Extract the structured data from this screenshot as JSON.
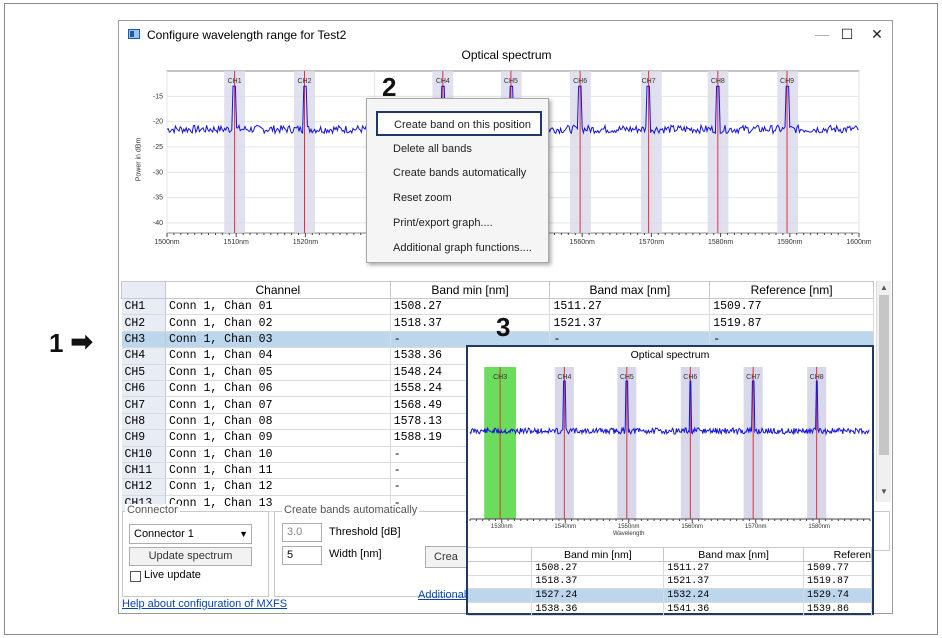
{
  "window": {
    "title": "Configure wavelength range for Test2",
    "minimize_glyph": "—",
    "maximize_glyph": "☐",
    "close_glyph": "✕"
  },
  "chart": {
    "title": "Optical spectrum",
    "ylabel": "Power in dBm"
  },
  "chart_data": [
    {
      "type": "line",
      "title": "Optical spectrum",
      "ylabel": "Power in dBm",
      "xlabel": "",
      "x_ticks": [
        "1500nm",
        "1510nm",
        "1520nm",
        "153",
        "1560nm",
        "1570nm",
        "1580nm",
        "1590nm",
        "1600nm"
      ],
      "y_ticks": [
        "-15",
        "-20",
        "-25",
        "-30",
        "-35",
        "-40"
      ],
      "xlim": [
        1500,
        1600
      ],
      "ylim": [
        -42,
        -10
      ],
      "noise_floor_dbm": -21.5,
      "band_labels": [
        "CH1",
        "CH2",
        "CH4",
        "CH5",
        "CH6",
        "CH7",
        "CH8",
        "CH9"
      ],
      "peaks": [
        {
          "x": 1509.77,
          "y": -13
        },
        {
          "x": 1519.87,
          "y": -13
        },
        {
          "x": 1539.86,
          "y": -13
        },
        {
          "x": 1549.7,
          "y": -13
        },
        {
          "x": 1559.7,
          "y": -13
        },
        {
          "x": 1569.6,
          "y": -13
        },
        {
          "x": 1579.6,
          "y": -13
        },
        {
          "x": 1589.6,
          "y": -13
        }
      ],
      "bands": [
        {
          "min": 1508.27,
          "max": 1511.27
        },
        {
          "min": 1518.37,
          "max": 1521.37
        },
        {
          "min": 1538.36,
          "max": 1541.36
        },
        {
          "min": 1548.24,
          "max": 1551.24
        },
        {
          "min": 1558.24,
          "max": 1561.24
        },
        {
          "min": 1568.49,
          "max": 1571.49
        },
        {
          "min": 1578.13,
          "max": 1581.13
        },
        {
          "min": 1588.19,
          "max": 1591.19
        }
      ],
      "grid": true
    },
    {
      "type": "line",
      "title": "Optical spectrum",
      "xlabel": "Wavelength",
      "x_ticks": [
        "1530nm",
        "1540nm",
        "1550nm",
        "1560nm",
        "1570nm",
        "1580nm"
      ],
      "xlim": [
        1525,
        1588
      ],
      "band_labels": [
        "CH3",
        "CH4",
        "CH5",
        "CH6",
        "CH7",
        "CH8"
      ],
      "highlight_band": {
        "label": "CH3",
        "min": 1527.24,
        "max": 1532.24
      },
      "peaks": [
        1539.86,
        1549.7,
        1559.7,
        1569.6,
        1579.6
      ]
    }
  ],
  "context_menu": {
    "items": [
      "Create band on this position",
      "Delete all bands",
      "Create bands automatically",
      "Reset zoom",
      "Print/export graph....",
      "Additional graph functions...."
    ]
  },
  "table": {
    "headers": [
      "Channel",
      "Band min [nm]",
      "Band max [nm]",
      "Reference [nm]"
    ],
    "rows": [
      [
        "CH1",
        "Conn 1, Chan 01",
        "1508.27",
        "1511.27",
        "1509.77"
      ],
      [
        "CH2",
        "Conn 1, Chan 02",
        "1518.37",
        "1521.37",
        "1519.87"
      ],
      [
        "CH3",
        "Conn 1, Chan 03",
        "-",
        "-",
        "-"
      ],
      [
        "CH4",
        "Conn 1, Chan 04",
        "1538.36",
        "",
        ""
      ],
      [
        "CH5",
        "Conn 1, Chan 05",
        "1548.24",
        "",
        ""
      ],
      [
        "CH6",
        "Conn 1, Chan 06",
        "1558.24",
        "",
        ""
      ],
      [
        "CH7",
        "Conn 1, Chan 07",
        "1568.49",
        "",
        ""
      ],
      [
        "CH8",
        "Conn 1, Chan 08",
        "1578.13",
        "",
        ""
      ],
      [
        "CH9",
        "Conn 1, Chan 09",
        "1588.19",
        "",
        ""
      ],
      [
        "CH10",
        "Conn 1, Chan 10",
        "-",
        "",
        ""
      ],
      [
        "CH11",
        "Conn 1, Chan 11",
        "-",
        "",
        ""
      ],
      [
        "CH12",
        "Conn 1, Chan 12",
        "-",
        "",
        ""
      ],
      [
        "CH13",
        "Conn 1, Chan 13",
        "-",
        "",
        ""
      ]
    ],
    "selected_row": "CH3"
  },
  "connector": {
    "label": "Connector",
    "select_value": "Connector 1",
    "update_button": "Update spectrum",
    "live_update_label": "Live update"
  },
  "auto_bands": {
    "label": "Create bands automatically",
    "threshold_value": "3.0",
    "threshold_label": "Threshold [dB]",
    "width_value": "5",
    "width_label": "Width [nm]",
    "create_button": "Crea"
  },
  "footer": {
    "help_link": "Help about configuration of MXFS",
    "additional_link": "Additional"
  },
  "callouts": {
    "one": "1",
    "two": "2",
    "three": "3",
    "arrow": "➡"
  },
  "inset": {
    "title": "Optical spectrum",
    "xlabel": "Wavelength",
    "headers": [
      "Band min [nm]",
      "Band max [nm]",
      "Referen"
    ],
    "rows": [
      [
        "1508.27",
        "1511.27",
        "1509.77"
      ],
      [
        "1518.37",
        "1521.37",
        "1519.87"
      ],
      [
        "1527.24",
        "1532.24",
        "1529.74"
      ],
      [
        "1538.36",
        "1541.36",
        "1539.86"
      ]
    ],
    "selected_row_index": 2
  },
  "colors": {
    "trace": "#1414d8",
    "band_fill": "#d8d8ea",
    "marker": "#e0303a",
    "highlight_band": "#6cdc5c",
    "selected_row": "#bcd6ee",
    "callout_border": "#1f3864"
  }
}
